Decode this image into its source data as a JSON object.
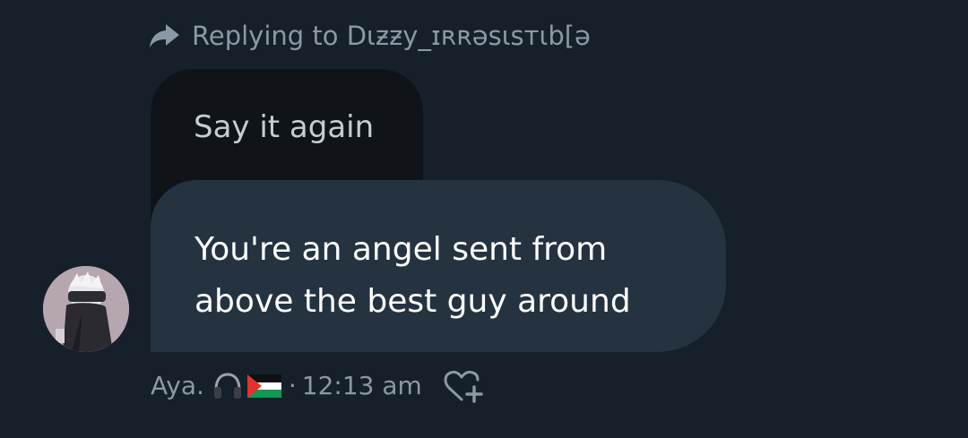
{
  "reply": {
    "icon": "reply-arrow-icon",
    "text": "Replying to Dɩƶƶy_ɪʀʀәsɩsтɩb[ә"
  },
  "quoted_message": {
    "text": "Say it again"
  },
  "message": {
    "line1": "You're an angel sent from",
    "line2": "above the best guy around"
  },
  "sender": {
    "name": "Aya.",
    "emoji_icons": [
      "headphone-icon",
      "palestine-flag-icon"
    ],
    "separator": "·",
    "time": "12:13 am",
    "react_icon": "add-reaction-heart-icon"
  },
  "colors": {
    "background": "#16202a",
    "quoted_bubble": "#101418",
    "message_bubble": "#253341",
    "meta_text": "#8b98a5",
    "message_text": "#ffffff"
  }
}
